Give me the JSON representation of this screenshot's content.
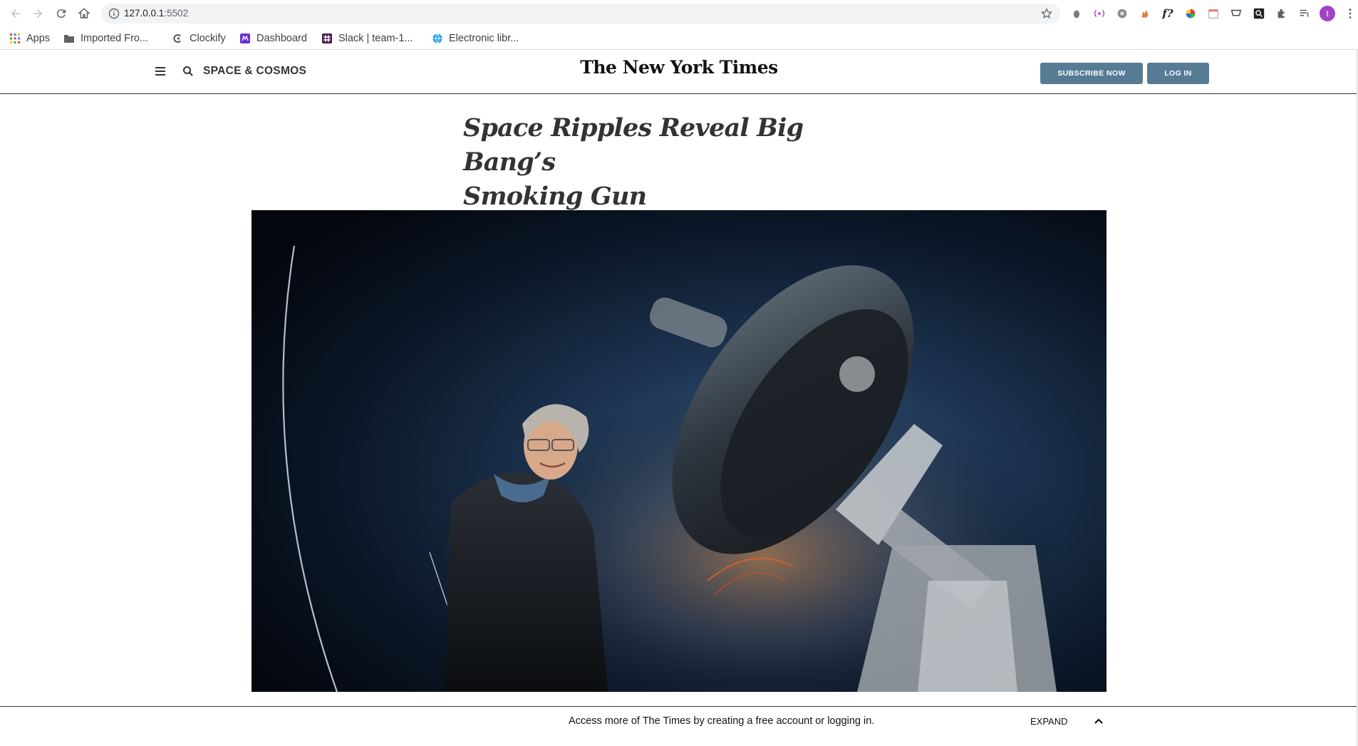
{
  "browser": {
    "url_host": "127.0.0.1",
    "url_port": ":5502",
    "profile_initial": "t",
    "accent_color": "#a142c6"
  },
  "bookmarks": [
    {
      "label": "Apps",
      "icon": "apps-grid-icon"
    },
    {
      "label": "Imported Fro...",
      "icon": "folder-icon"
    },
    {
      "label": "Clockify",
      "icon": "clockify-icon"
    },
    {
      "label": "Dashboard",
      "icon": "dashboard-icon"
    },
    {
      "label": "Slack | team-1...",
      "icon": "slack-icon"
    },
    {
      "label": "Electronic libr...",
      "icon": "globe-icon"
    }
  ],
  "header": {
    "section": "SPACE & COSMOS",
    "masthead": "The New York Times",
    "subscribe_label": "SUBSCRIBE NOW",
    "login_label": "LOG IN",
    "button_color": "#567b95"
  },
  "article": {
    "headline_line1": "Space Ripples Reveal Big Bang’s",
    "headline_line2": "Smoking Gun"
  },
  "gateway": {
    "message": "Access more of The Times by creating a free account or logging in.",
    "expand_label": "EXPAND"
  }
}
